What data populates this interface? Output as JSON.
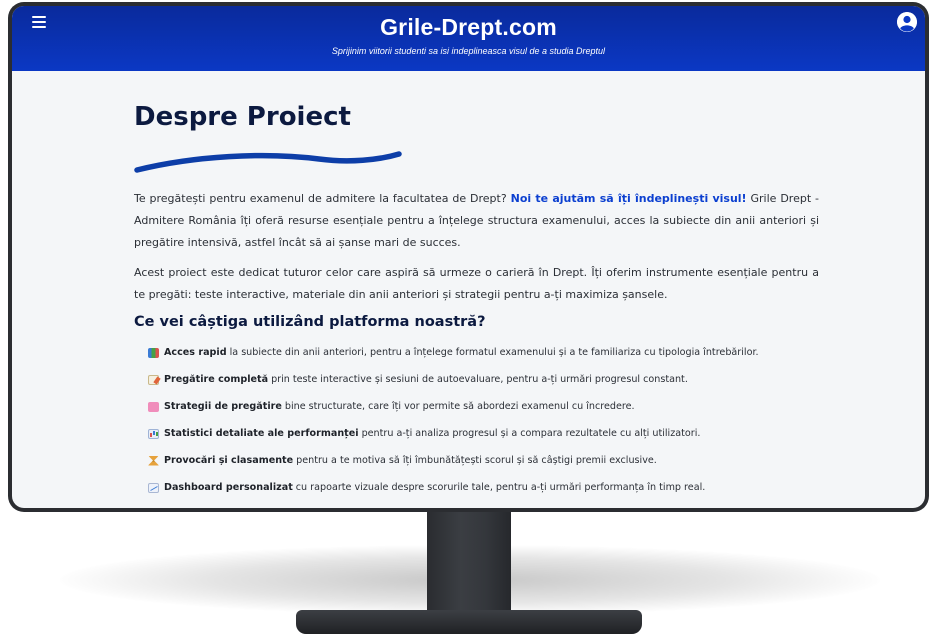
{
  "header": {
    "title": "Grile-Drept.com",
    "tagline": "Sprijinim viitorii studenti sa isi indeplineasca visul de a studia Dreptul",
    "menu_icon": "hamburger-icon",
    "user_icon": "user-circle-icon",
    "background": "#0b38c4"
  },
  "main": {
    "title": "Despre Proiect",
    "accent_color": "#0b3fd0",
    "intro": {
      "before": "Te pregătești pentru examenul de admitere la facultatea de Drept? ",
      "highlight": "Noi te ajutăm să îți îndeplinești visul!",
      "after": " Grile Drept - Admitere România îți oferă resurse esențiale pentru a înțelege structura examenului, acces la subiecte din anii anteriori și pregătire intensivă, astfel încât să ai șanse mari de succes."
    },
    "paragraph2": "Acest proiect este dedicat tuturor celor care aspiră să urmeze o carieră în Drept. Îți oferim instrumente esențiale pentru a te pregăti: teste interactive, materiale din anii anteriori și strategii pentru a-ți maximiza șansele.",
    "section_title": "Ce vei câștiga utilizând platforma noastră?",
    "features": [
      {
        "icon": "books-icon",
        "bold": "Acces rapid",
        "text": "la subiecte din anii anteriori, pentru a înțelege formatul examenului și a te familiariza cu tipologia întrebărilor."
      },
      {
        "icon": "memo-icon",
        "bold": "Pregătire completă",
        "text": "prin teste interactive și sesiuni de autoevaluare, pentru a-ți urmări progresul constant."
      },
      {
        "icon": "brain-icon",
        "bold": "Strategii de pregătire",
        "text": "bine structurate, care îți vor permite să abordezi examenul cu încredere."
      },
      {
        "icon": "bar-chart-icon",
        "bold": "Statistici detaliate ale performanței",
        "text": "pentru a-ți analiza progresul și a compara rezultatele cu alți utilizatori."
      },
      {
        "icon": "hourglass-icon",
        "bold": "Provocări și clasamente",
        "text": "pentru a te motiva să îți îmbunătățești scorul și să câștigi premii exclusive."
      },
      {
        "icon": "trend-chart-icon",
        "bold": "Dashboard personalizat",
        "text": "cu rapoarte vizuale despre scorurile tale, pentru a-ți urmări performanța în timp real."
      }
    ]
  }
}
